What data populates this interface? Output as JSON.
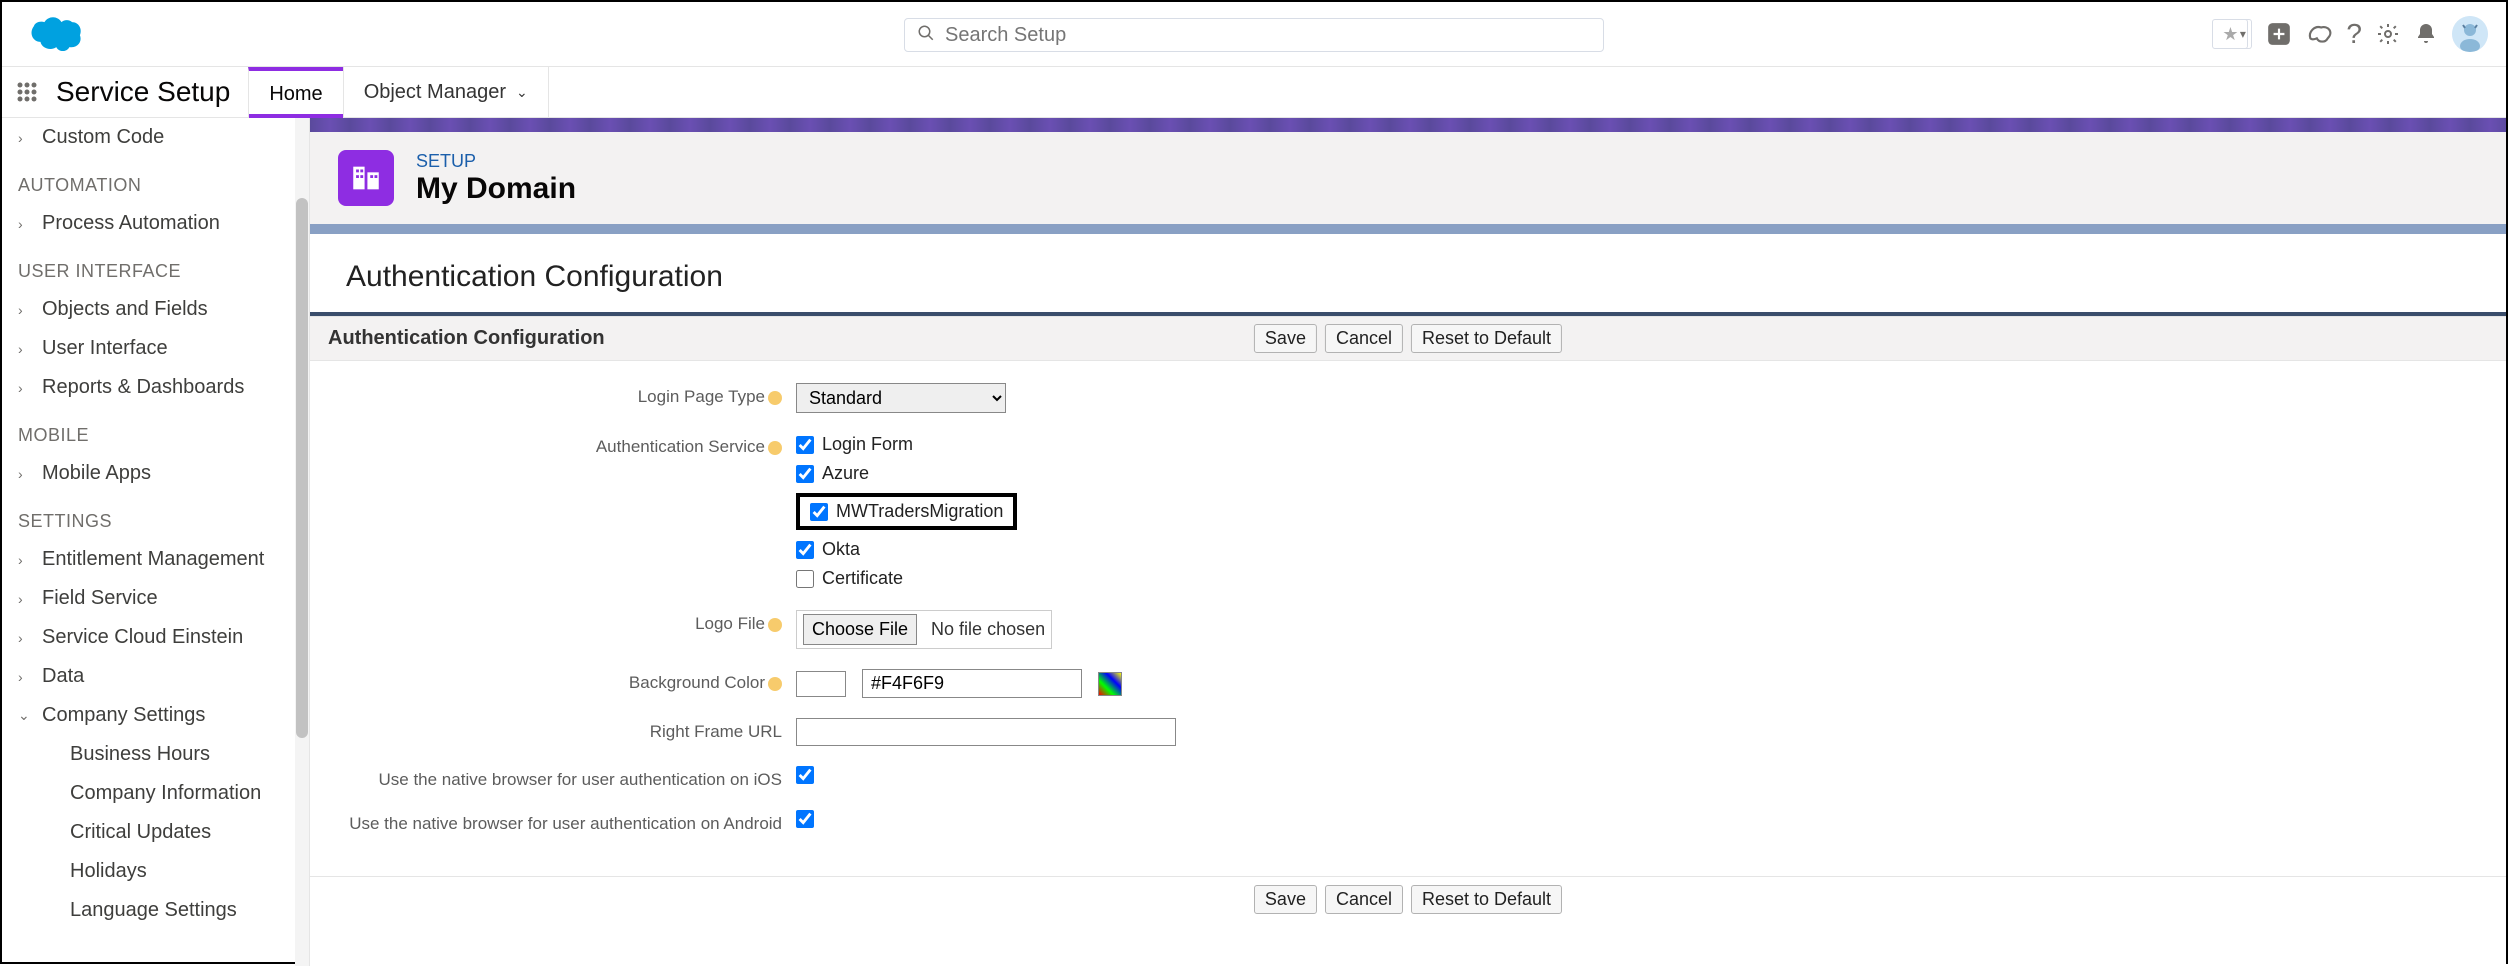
{
  "header": {
    "search_placeholder": "Search Setup"
  },
  "nav": {
    "app_title": "Service Setup",
    "tabs": [
      {
        "label": "Home",
        "active": true
      },
      {
        "label": "Object Manager",
        "active": false,
        "dropdown": true
      }
    ]
  },
  "sidebar": {
    "top_item": "Custom Code",
    "sections": [
      {
        "heading": "AUTOMATION",
        "items": [
          {
            "label": "Process Automation",
            "caret": ">"
          }
        ]
      },
      {
        "heading": "USER INTERFACE",
        "items": [
          {
            "label": "Objects and Fields",
            "caret": ">"
          },
          {
            "label": "User Interface",
            "caret": ">"
          },
          {
            "label": "Reports & Dashboards",
            "caret": ">"
          }
        ]
      },
      {
        "heading": "MOBILE",
        "items": [
          {
            "label": "Mobile Apps",
            "caret": ">"
          }
        ]
      },
      {
        "heading": "SETTINGS",
        "items": [
          {
            "label": "Entitlement Management",
            "caret": ">"
          },
          {
            "label": "Field Service",
            "caret": ">"
          },
          {
            "label": "Service Cloud Einstein",
            "caret": ">"
          },
          {
            "label": "Data",
            "caret": ">"
          },
          {
            "label": "Company Settings",
            "caret": "v",
            "children": [
              "Business Hours",
              "Company Information",
              "Critical Updates",
              "Holidays",
              "Language Settings"
            ]
          }
        ]
      }
    ]
  },
  "page": {
    "eyebrow": "SETUP",
    "title": "My Domain"
  },
  "section": {
    "title": "Authentication Configuration",
    "panel_title": "Authentication Configuration"
  },
  "buttons": {
    "save": "Save",
    "cancel": "Cancel",
    "reset": "Reset to Default",
    "choose_file": "Choose File",
    "no_file": "No file chosen"
  },
  "form": {
    "login_page_type_label": "Login Page Type",
    "login_page_type_value": "Standard",
    "auth_service_label": "Authentication Service",
    "auth_services": [
      {
        "label": "Login Form",
        "checked": true,
        "highlight": false
      },
      {
        "label": "Azure",
        "checked": true,
        "highlight": false
      },
      {
        "label": "MWTradersMigration",
        "checked": true,
        "highlight": true
      },
      {
        "label": "Okta",
        "checked": true,
        "highlight": false
      },
      {
        "label": "Certificate",
        "checked": false,
        "highlight": false
      }
    ],
    "logo_file_label": "Logo File",
    "bg_color_label": "Background Color",
    "bg_color_value": "#F4F6F9",
    "right_frame_label": "Right Frame URL",
    "right_frame_value": "",
    "native_ios_label": "Use the native browser for user authentication on iOS",
    "native_ios_checked": true,
    "native_android_label": "Use the native browser for user authentication on Android",
    "native_android_checked": true
  }
}
